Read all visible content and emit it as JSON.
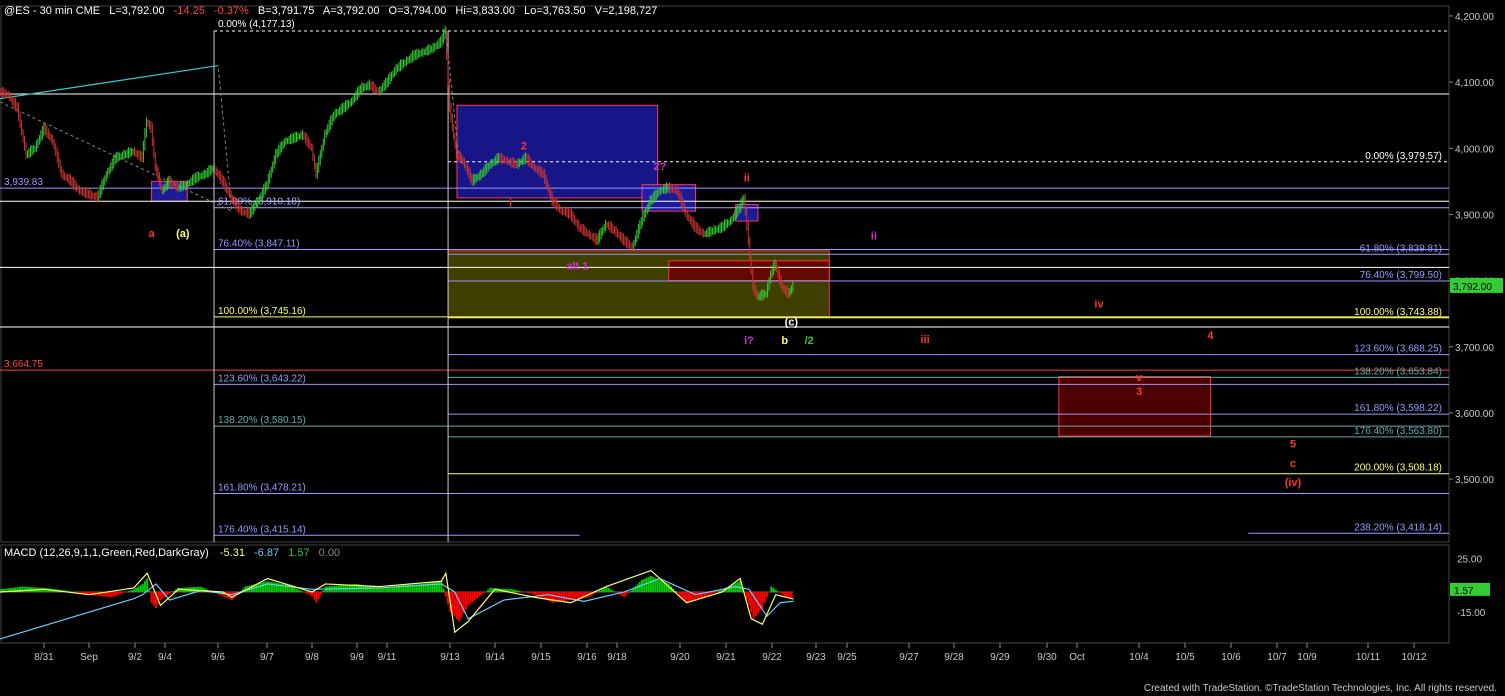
{
  "header": {
    "symbol": "@ES - 30 min  CME",
    "last": "L=3,792.00",
    "change": "-14.25",
    "pct": "-0.37%",
    "bid": "B=3,791.75",
    "ask": "A=3,792.00",
    "open": "O=3,794.00",
    "hi": "Hi=3,833.00",
    "lo": "Lo=3,763.50",
    "vol": "V=2,198,727"
  },
  "macd_header": {
    "name": "MACD (12,26,9,1,1,Green,Red,DarkGray)",
    "v1": "-5.31",
    "v2": "-6.87",
    "v3": "1.57",
    "v4": "0.00"
  },
  "footer": "Created with TradeStation. ©TradeStation Technologies, Inc. All rights reserved.",
  "colors": {
    "background": "#000000",
    "up_bar": "#33cc33",
    "down_bar": "#cc3333",
    "macd_hist_up": "#00cc00",
    "macd_hist_down": "#ff0000",
    "macd_line": "#ffff66",
    "signal_line": "#66ccff",
    "fib_white": "#ffffff",
    "fib_blue": "#9999ff",
    "fib_teal": "#66aaaa",
    "fib_yellow": "#ffff66"
  },
  "chart_data": {
    "type": "candlestick",
    "price_axis": {
      "ticks": [
        "4,200.00",
        "4,100.00",
        "4,000.00",
        "3,900.00",
        "3,800.00",
        "3,700.00",
        "3,600.00",
        "3,500.00"
      ],
      "tick_values": [
        4200,
        4100,
        4000,
        3900,
        3800,
        3700,
        3600,
        3500
      ],
      "ylim": [
        3405,
        4215
      ],
      "last_price_tag": "3,792.00",
      "last_price": 3792
    },
    "macd_axis": {
      "ticks": [
        "25.00",
        "1.57",
        "-15.00"
      ],
      "tick_values": [
        25,
        1.57,
        -15
      ],
      "ylim": [
        -38,
        35
      ]
    },
    "date_labels": [
      "8/31",
      "Sep",
      "9/2",
      "9/4",
      "9/6",
      "9/7",
      "9/8",
      "9/9",
      "9/11",
      "9/13",
      "9/14",
      "9/15",
      "9/16",
      "9/18",
      "9/20",
      "9/21",
      "9/22",
      "9/23",
      "9/25",
      "9/27",
      "9/28",
      "9/29",
      "9/30",
      "Oct",
      "10/4",
      "10/5",
      "10/6",
      "10/7",
      "10/9",
      "10/11",
      "10/12"
    ],
    "price_path": [
      [
        0,
        4085
      ],
      [
        4,
        4080
      ],
      [
        8,
        4060
      ],
      [
        12,
        3990
      ],
      [
        16,
        4000
      ],
      [
        20,
        4030
      ],
      [
        24,
        4010
      ],
      [
        28,
        3960
      ],
      [
        32,
        3950
      ],
      [
        36,
        3935
      ],
      [
        40,
        3930
      ],
      [
        44,
        3925
      ],
      [
        48,
        3960
      ],
      [
        52,
        3985
      ],
      [
        56,
        3990
      ],
      [
        60,
        3995
      ],
      [
        64,
        3985
      ],
      [
        66,
        4040
      ],
      [
        68,
        4030
      ],
      [
        70,
        3970
      ],
      [
        73,
        3935
      ],
      [
        76,
        3950
      ],
      [
        80,
        3940
      ],
      [
        84,
        3945
      ],
      [
        88,
        3955
      ],
      [
        92,
        3960
      ],
      [
        96,
        3970
      ],
      [
        100,
        3950
      ],
      [
        104,
        3925
      ],
      [
        108,
        3905
      ],
      [
        112,
        3900
      ],
      [
        116,
        3920
      ],
      [
        120,
        3945
      ],
      [
        124,
        3990
      ],
      [
        128,
        4010
      ],
      [
        132,
        4015
      ],
      [
        136,
        4020
      ],
      [
        140,
        4000
      ],
      [
        142,
        3960
      ],
      [
        146,
        4020
      ],
      [
        150,
        4050
      ],
      [
        154,
        4060
      ],
      [
        158,
        4070
      ],
      [
        162,
        4090
      ],
      [
        166,
        4095
      ],
      [
        170,
        4085
      ],
      [
        174,
        4100
      ],
      [
        178,
        4120
      ],
      [
        182,
        4130
      ],
      [
        186,
        4140
      ],
      [
        190,
        4145
      ],
      [
        194,
        4150
      ],
      [
        198,
        4160
      ],
      [
        200,
        4177
      ],
      [
        202,
        4060
      ],
      [
        205,
        3990
      ],
      [
        208,
        3980
      ],
      [
        212,
        3950
      ],
      [
        216,
        3960
      ],
      [
        220,
        3975
      ],
      [
        224,
        3985
      ],
      [
        228,
        3980
      ],
      [
        232,
        3975
      ],
      [
        236,
        3985
      ],
      [
        240,
        3970
      ],
      [
        244,
        3960
      ],
      [
        248,
        3920
      ],
      [
        252,
        3905
      ],
      [
        256,
        3900
      ],
      [
        260,
        3880
      ],
      [
        264,
        3870
      ],
      [
        268,
        3860
      ],
      [
        272,
        3885
      ],
      [
        276,
        3875
      ],
      [
        280,
        3860
      ],
      [
        284,
        3850
      ],
      [
        288,
        3890
      ],
      [
        292,
        3920
      ],
      [
        296,
        3935
      ],
      [
        300,
        3940
      ],
      [
        304,
        3935
      ],
      [
        308,
        3900
      ],
      [
        312,
        3880
      ],
      [
        316,
        3870
      ],
      [
        320,
        3875
      ],
      [
        324,
        3880
      ],
      [
        328,
        3890
      ],
      [
        332,
        3910
      ],
      [
        334,
        3925
      ],
      [
        336,
        3860
      ],
      [
        338,
        3790
      ],
      [
        340,
        3775
      ],
      [
        344,
        3780
      ],
      [
        346,
        3810
      ],
      [
        348,
        3825
      ],
      [
        350,
        3800
      ],
      [
        352,
        3785
      ],
      [
        354,
        3780
      ],
      [
        356,
        3792
      ]
    ],
    "rect_zones": [
      {
        "price_top": 4065,
        "price_bottom": 3925,
        "t_left": 205,
        "t_right": 295,
        "fill": "#1a1aa0",
        "stroke": "#ff3366"
      },
      {
        "price_top": 3950,
        "price_bottom": 3920,
        "t_left": 68,
        "t_right": 84,
        "fill": "#2020b0",
        "stroke": "#ff3366"
      },
      {
        "price_top": 3945,
        "price_bottom": 3905,
        "t_left": 288,
        "t_right": 312,
        "fill": "#2020b0",
        "stroke": "#ff3366"
      },
      {
        "price_top": 3915,
        "price_bottom": 3890,
        "t_left": 330,
        "t_right": 340,
        "fill": "#2020b0",
        "stroke": "#ff3366"
      },
      {
        "price_top": 3845,
        "price_bottom": 3745,
        "t_left": 201,
        "t_right": 372,
        "fill": "#4a4a00",
        "stroke": "#ff3333"
      },
      {
        "price_top": 3830,
        "price_bottom": 3800,
        "t_left": 300,
        "t_right": 372,
        "fill": "#6a0000",
        "stroke": "#ff3333"
      },
      {
        "price_top": 3655,
        "price_bottom": 3565,
        "t_left": 475,
        "t_right": 543,
        "fill": "#5a0000",
        "stroke": "#ff3333"
      }
    ],
    "fib_lines": [
      {
        "price": 4177.13,
        "t_left": 96,
        "t_right": 650,
        "color": "#ffffff",
        "dashed": true,
        "label": "0.00% (4,177.13)",
        "label_side": "left-top"
      },
      {
        "price": 4082,
        "t_left": 0,
        "t_right": 650,
        "color": "#ffffff",
        "dashed": false,
        "label": "",
        "label_side": ""
      },
      {
        "price": 3979.57,
        "t_left": 201,
        "t_right": 650,
        "color": "#ffffff",
        "dashed": true,
        "label": "0.00% (3,979.57)",
        "label_side": "right"
      },
      {
        "price": 3939.83,
        "t_left": 0,
        "t_right": 650,
        "color": "#9999ff",
        "dashed": false,
        "label": "3,939.83",
        "label_side": "left"
      },
      {
        "price": 3920,
        "t_left": 0,
        "t_right": 650,
        "color": "#ffffff",
        "dashed": false,
        "label": "",
        "label_side": ""
      },
      {
        "price": 3910.18,
        "t_left": 96,
        "t_right": 650,
        "color": "#aaaaff",
        "dashed": false,
        "label": "61.80% (3,910.18)",
        "label_side": "left-mid"
      },
      {
        "price": 3847.11,
        "t_left": 96,
        "t_right": 650,
        "color": "#9999ff",
        "dashed": false,
        "label": "76.40% (3,847.11)",
        "label_side": "left-mid"
      },
      {
        "price": 3839.81,
        "t_left": 201,
        "t_right": 650,
        "color": "#9999ff",
        "dashed": false,
        "label": "61.80% (3,839.81)",
        "label_side": "right"
      },
      {
        "price": 3820,
        "t_left": 0,
        "t_right": 650,
        "color": "#ffffff",
        "dashed": false,
        "label": "",
        "label_side": ""
      },
      {
        "price": 3799.5,
        "t_left": 201,
        "t_right": 650,
        "color": "#9999ff",
        "dashed": false,
        "label": "76.40% (3,799.50)",
        "label_side": "right"
      },
      {
        "price": 3745.16,
        "t_left": 96,
        "t_right": 650,
        "color": "#ffff66",
        "dashed": false,
        "label": "100.00% (3,745.16)",
        "label_side": "left-mid"
      },
      {
        "price": 3743.88,
        "t_left": 201,
        "t_right": 650,
        "color": "#ffff66",
        "dashed": false,
        "label": "100.00% (3,743.88)",
        "label_side": "right"
      },
      {
        "price": 3730,
        "t_left": 0,
        "t_right": 650,
        "color": "#ffffff",
        "dashed": false,
        "label": "",
        "label_side": ""
      },
      {
        "price": 3688.25,
        "t_left": 201,
        "t_right": 650,
        "color": "#9999ff",
        "dashed": false,
        "label": "123.60% (3,688.25)",
        "label_side": "right"
      },
      {
        "price": 3664.75,
        "t_left": 0,
        "t_right": 650,
        "color": "#ff4444",
        "dashed": false,
        "label": "3,664.75",
        "label_side": "left"
      },
      {
        "price": 3653.84,
        "t_left": 201,
        "t_right": 650,
        "color": "#66aaaa",
        "dashed": false,
        "label": "138.20% (3,653.84)",
        "label_side": "right"
      },
      {
        "price": 3643.22,
        "t_left": 96,
        "t_right": 650,
        "color": "#9999ff",
        "dashed": false,
        "label": "123.60% (3,643.22)",
        "label_side": "left-mid"
      },
      {
        "price": 3598.22,
        "t_left": 201,
        "t_right": 650,
        "color": "#9999ff",
        "dashed": false,
        "label": "161.80% (3,598.22)",
        "label_side": "right"
      },
      {
        "price": 3580.15,
        "t_left": 96,
        "t_right": 650,
        "color": "#66aaaa",
        "dashed": false,
        "label": "138.20% (3,580.15)",
        "label_side": "left-mid"
      },
      {
        "price": 3563.8,
        "t_left": 201,
        "t_right": 650,
        "color": "#66aaaa",
        "dashed": false,
        "label": "176.40% (3,563.80)",
        "label_side": "right"
      },
      {
        "price": 3508.18,
        "t_left": 201,
        "t_right": 650,
        "color": "#ffff66",
        "dashed": false,
        "label": "200.00% (3,508.18)",
        "label_side": "right"
      },
      {
        "price": 3478.21,
        "t_left": 96,
        "t_right": 650,
        "color": "#9999ff",
        "dashed": false,
        "label": "161.80% (3,478.21)",
        "label_side": "left-mid"
      },
      {
        "price": 3415.14,
        "t_left": 96,
        "t_right": 260,
        "color": "#9999ff",
        "dashed": false,
        "label": "176.40% (3,415.14)",
        "label_side": "left-mid"
      },
      {
        "price": 3418.14,
        "t_left": 560,
        "t_right": 650,
        "color": "#9999ff",
        "dashed": false,
        "label": "238.20% (3,418.14)",
        "label_side": "right"
      }
    ],
    "wave_labels": [
      {
        "text": "a",
        "t": 68,
        "price": 3866,
        "color": "#ff3333"
      },
      {
        "text": "(a)",
        "t": 82,
        "price": 3866,
        "color": "#ffff66"
      },
      {
        "text": "2",
        "t": 235,
        "price": 3998,
        "color": "#ff3333"
      },
      {
        "text": "i",
        "t": 229,
        "price": 3912,
        "color": "#ff3333"
      },
      {
        "text": "2?",
        "t": 296,
        "price": 3967,
        "color": "#cc33cc"
      },
      {
        "text": "ii",
        "t": 335,
        "price": 3950,
        "color": "#ff3333"
      },
      {
        "text": "ii",
        "t": 392,
        "price": 3862,
        "color": "#cc33cc"
      },
      {
        "text": "alt 1",
        "t": 259,
        "price": 3817,
        "color": "#cc33cc"
      },
      {
        "text": "(c)",
        "t": 355,
        "price": 3732,
        "color": "#ffffff"
      },
      {
        "text": "i?",
        "t": 336,
        "price": 3704,
        "color": "#cc33cc"
      },
      {
        "text": "b",
        "t": 352,
        "price": 3704,
        "color": "#ffff66"
      },
      {
        "text": "/2",
        "t": 363,
        "price": 3704,
        "color": "#33cc33"
      },
      {
        "text": "iii",
        "t": 415,
        "price": 3706,
        "color": "#ff3333"
      },
      {
        "text": "iv",
        "t": 493,
        "price": 3759,
        "color": "#ff3333"
      },
      {
        "text": "4",
        "t": 543,
        "price": 3712,
        "color": "#ff3333"
      },
      {
        "text": "v",
        "t": 511,
        "price": 3648,
        "color": "#ff3333"
      },
      {
        "text": "3",
        "t": 511,
        "price": 3627,
        "color": "#ff3333"
      },
      {
        "text": "5",
        "t": 580,
        "price": 3548,
        "color": "#ff3333"
      },
      {
        "text": "c",
        "t": 580,
        "price": 3518,
        "color": "#ff3333"
      },
      {
        "text": "(iv)",
        "t": 580,
        "price": 3490,
        "color": "#ff3333"
      }
    ],
    "macd": {
      "hist": [
        [
          0,
          2
        ],
        [
          10,
          4
        ],
        [
          20,
          3
        ],
        [
          30,
          1
        ],
        [
          40,
          -2
        ],
        [
          50,
          -4
        ],
        [
          60,
          2
        ],
        [
          64,
          6
        ],
        [
          66,
          10
        ],
        [
          68,
          -8
        ],
        [
          70,
          -12
        ],
        [
          72,
          -6
        ],
        [
          80,
          3
        ],
        [
          90,
          4
        ],
        [
          100,
          -3
        ],
        [
          104,
          -6
        ],
        [
          110,
          4
        ],
        [
          120,
          8
        ],
        [
          130,
          5
        ],
        [
          140,
          -3
        ],
        [
          142,
          -8
        ],
        [
          146,
          4
        ],
        [
          160,
          6
        ],
        [
          170,
          3
        ],
        [
          180,
          5
        ],
        [
          190,
          6
        ],
        [
          198,
          8
        ],
        [
          202,
          -15
        ],
        [
          206,
          -22
        ],
        [
          210,
          -10
        ],
        [
          220,
          3
        ],
        [
          230,
          2
        ],
        [
          240,
          -2
        ],
        [
          248,
          -8
        ],
        [
          256,
          -6
        ],
        [
          264,
          -4
        ],
        [
          272,
          4
        ],
        [
          280,
          -4
        ],
        [
          288,
          9
        ],
        [
          292,
          12
        ],
        [
          300,
          6
        ],
        [
          308,
          -8
        ],
        [
          316,
          -4
        ],
        [
          324,
          2
        ],
        [
          332,
          8
        ],
        [
          336,
          -10
        ],
        [
          338,
          -20
        ],
        [
          342,
          -12
        ],
        [
          346,
          4
        ],
        [
          352,
          -3
        ],
        [
          356,
          -5
        ]
      ],
      "line": [
        [
          0,
          0
        ],
        [
          20,
          2
        ],
        [
          40,
          -2
        ],
        [
          60,
          3
        ],
        [
          66,
          14
        ],
        [
          72,
          -10
        ],
        [
          80,
          2
        ],
        [
          100,
          0
        ],
        [
          104,
          -4
        ],
        [
          120,
          10
        ],
        [
          140,
          0
        ],
        [
          146,
          6
        ],
        [
          170,
          4
        ],
        [
          198,
          8
        ],
        [
          200,
          14
        ],
        [
          204,
          -30
        ],
        [
          210,
          -22
        ],
        [
          222,
          2
        ],
        [
          240,
          -4
        ],
        [
          256,
          -8
        ],
        [
          272,
          4
        ],
        [
          292,
          16
        ],
        [
          308,
          -8
        ],
        [
          324,
          0
        ],
        [
          332,
          10
        ],
        [
          337,
          -20
        ],
        [
          342,
          -24
        ],
        [
          348,
          -2
        ],
        [
          356,
          -5.3
        ]
      ],
      "signal": [
        [
          0,
          -35
        ],
        [
          60,
          -5
        ],
        [
          64,
          -2
        ],
        [
          70,
          6
        ],
        [
          76,
          -6
        ],
        [
          90,
          1
        ],
        [
          104,
          -2
        ],
        [
          120,
          6
        ],
        [
          140,
          2
        ],
        [
          170,
          3
        ],
        [
          198,
          6
        ],
        [
          204,
          0
        ],
        [
          210,
          -20
        ],
        [
          226,
          -6
        ],
        [
          246,
          -2
        ],
        [
          262,
          -7
        ],
        [
          280,
          0
        ],
        [
          296,
          10
        ],
        [
          312,
          -2
        ],
        [
          330,
          4
        ],
        [
          336,
          2
        ],
        [
          344,
          -18
        ],
        [
          350,
          -8
        ],
        [
          356,
          -6.9
        ]
      ]
    }
  }
}
